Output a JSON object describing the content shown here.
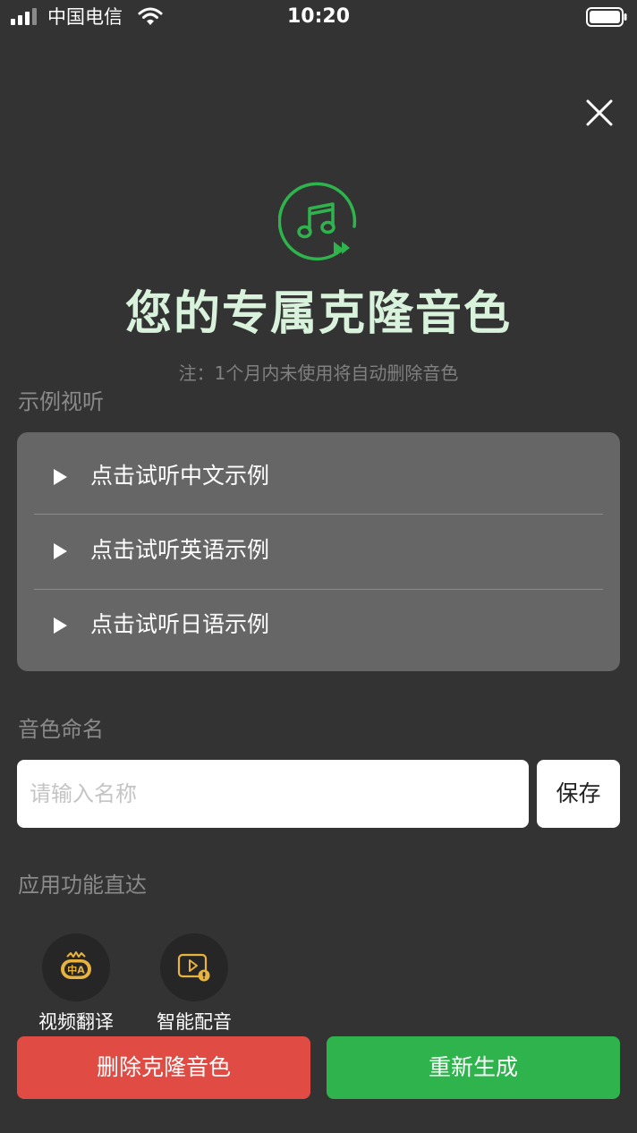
{
  "status_bar": {
    "carrier": "中国电信",
    "time": "10:20",
    "icons": [
      "signal-icon",
      "wifi-icon",
      "battery-icon"
    ]
  },
  "header": {
    "close_icon": "close-icon",
    "logo_icon": "music-note-icon",
    "title": "您的专属克隆音色",
    "note": "注：1个月内未使用将自动删除音色"
  },
  "samples": {
    "section_label": "示例视听",
    "items": [
      {
        "label": "点击试听中文示例",
        "icon": "play-icon"
      },
      {
        "label": "点击试听英语示例",
        "icon": "play-icon"
      },
      {
        "label": "点击试听日语示例",
        "icon": "play-icon"
      }
    ]
  },
  "naming": {
    "section_label": "音色命名",
    "input_value": "",
    "input_placeholder": "请输入名称",
    "save_label": "保存"
  },
  "shortcuts": {
    "section_label": "应用功能直达",
    "items": [
      {
        "label": "视频翻译",
        "icon": "video-translate-icon"
      },
      {
        "label": "智能配音",
        "icon": "smart-dubbing-icon"
      }
    ]
  },
  "actions": {
    "delete_label": "删除克隆音色",
    "regenerate_label": "重新生成"
  },
  "colors": {
    "background": "#333333",
    "card": "#666666",
    "accent_green": "#2fb44d",
    "danger_red": "#e04c44",
    "title_tint": "#d8f2dc",
    "icon_gold": "#e8b33e"
  }
}
